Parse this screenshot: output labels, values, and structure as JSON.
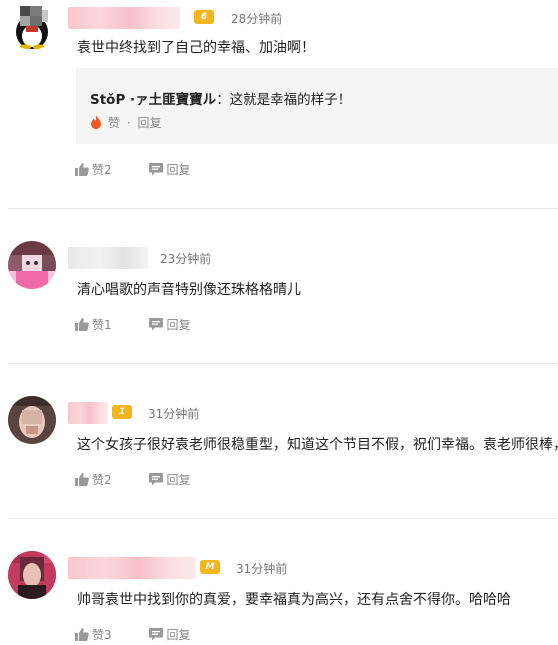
{
  "comments": [
    {
      "time": "28分钟前",
      "text": "袁世中终找到了自己的幸福、加油啊！",
      "reply": {
        "user": "StǒP ·ァ土匪寶寶ル",
        "text": "：这就是幸福的样子！",
        "like_label": "赞",
        "separator": "·",
        "reply_label": "回复"
      },
      "likes": "赞2",
      "reply_label": "回复"
    },
    {
      "time": "23分钟前",
      "text": "清心唱歌的声音特别像还珠格格晴儿",
      "likes": "赞1",
      "reply_label": "回复"
    },
    {
      "time": "31分钟前",
      "text": "这个女孩子很好袁老师很稳重型，知道这个节目不假，祝们幸福。袁老师很棒，",
      "likes": "赞2",
      "reply_label": "回复"
    },
    {
      "time": "31分钟前",
      "text": "帅哥袁世中找到你的真爱，要幸福真为高兴，还有点舍不得你。哈哈哈",
      "likes": "赞3",
      "reply_label": "回复"
    }
  ],
  "colors": {
    "badge": "#f3b61f",
    "fire": "#f05a22",
    "divider": "#e8e8e8"
  }
}
